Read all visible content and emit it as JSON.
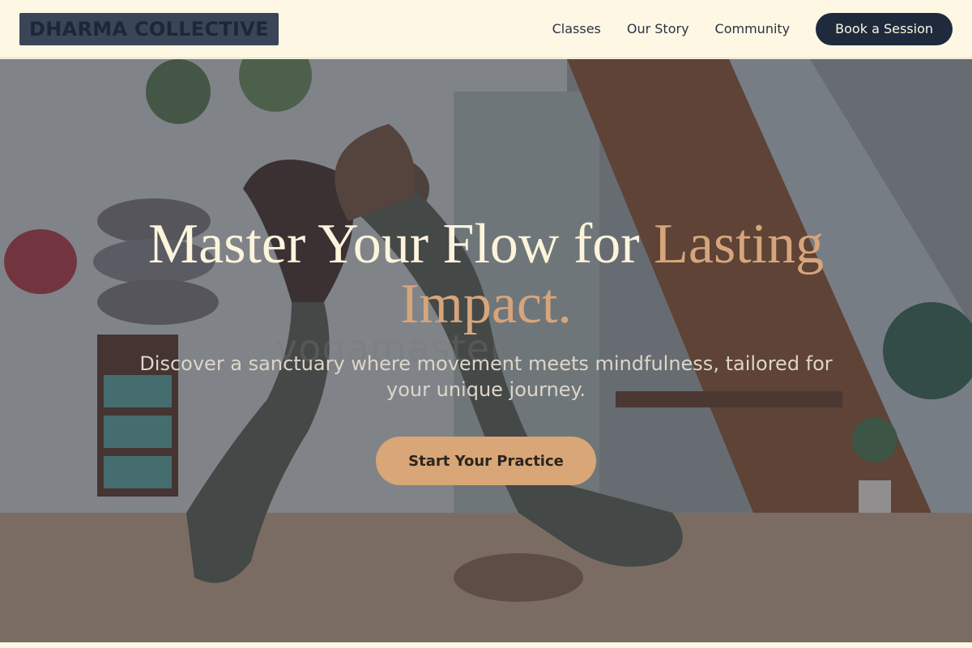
{
  "brand": {
    "name": "DHARMA COLLECTIVE"
  },
  "nav": {
    "items": [
      "Classes",
      "Our Story",
      "Community"
    ],
    "cta": "Book a Session"
  },
  "hero": {
    "title_main": "Master Your Flow for ",
    "title_accent": "Lasting Impact.",
    "subtitle": "Discover a sanctuary where movement meets mindfulness, tailored for your unique journey.",
    "button": "Start Your Practice",
    "watermark": "yogamaster"
  },
  "colors": {
    "header_bg": "#fdf7e3",
    "navy": "#1f2a3d",
    "accent": "#d6a57c",
    "button": "#d9a677"
  }
}
